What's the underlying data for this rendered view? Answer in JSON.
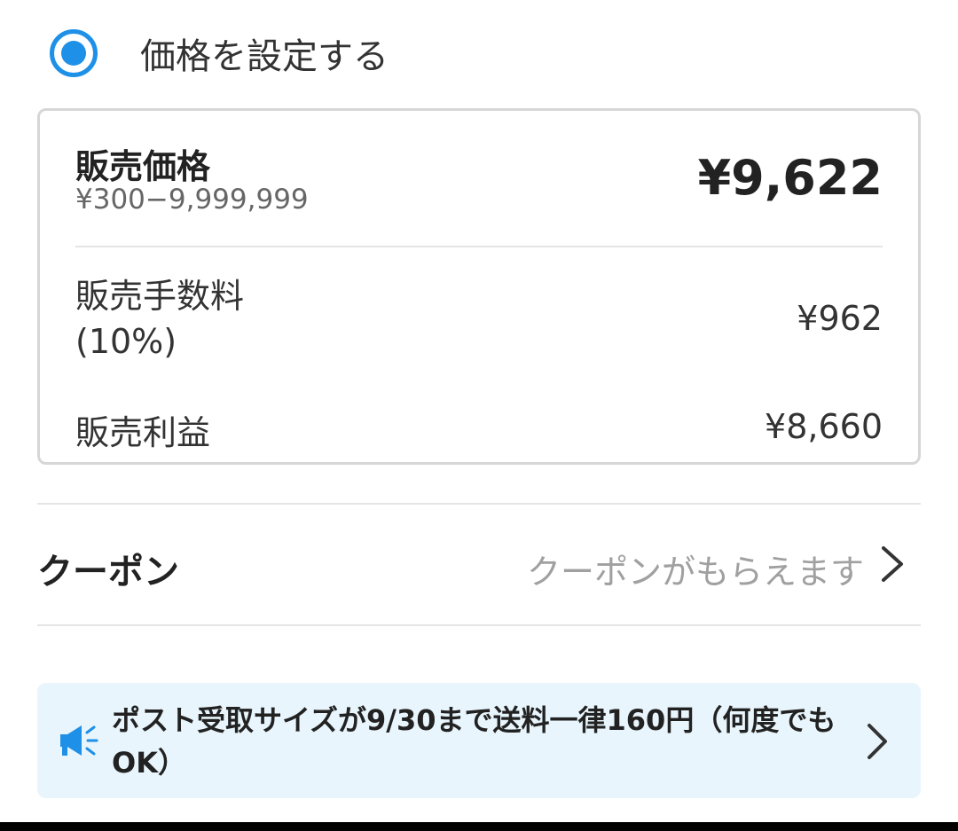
{
  "pricing_option": {
    "label": "価格を設定する",
    "selected": true
  },
  "price_card": {
    "price_label": "販売価格",
    "price_range": "¥300−9,999,999",
    "price_value": "¥9,622",
    "fee_label": "販売手数料",
    "fee_rate": "(10%)",
    "fee_value": "¥962",
    "profit_label": "販売利益",
    "profit_value": "¥8,660"
  },
  "coupon": {
    "label": "クーポン",
    "hint": "クーポンがもらえます"
  },
  "banner": {
    "text": "ポスト受取サイズが9/30まで送料一律160円（何度でもOK）"
  },
  "colors": {
    "accent": "#1e90e8",
    "banner_bg": "#e8f5fc",
    "hint_gray": "#a0a0a0",
    "border": "#d6d6d6"
  },
  "icons": {
    "radio": "radio-selected-icon",
    "coupon_chevron": "chevron-right-icon",
    "banner_icon": "megaphone-icon",
    "banner_chevron": "chevron-right-icon"
  }
}
